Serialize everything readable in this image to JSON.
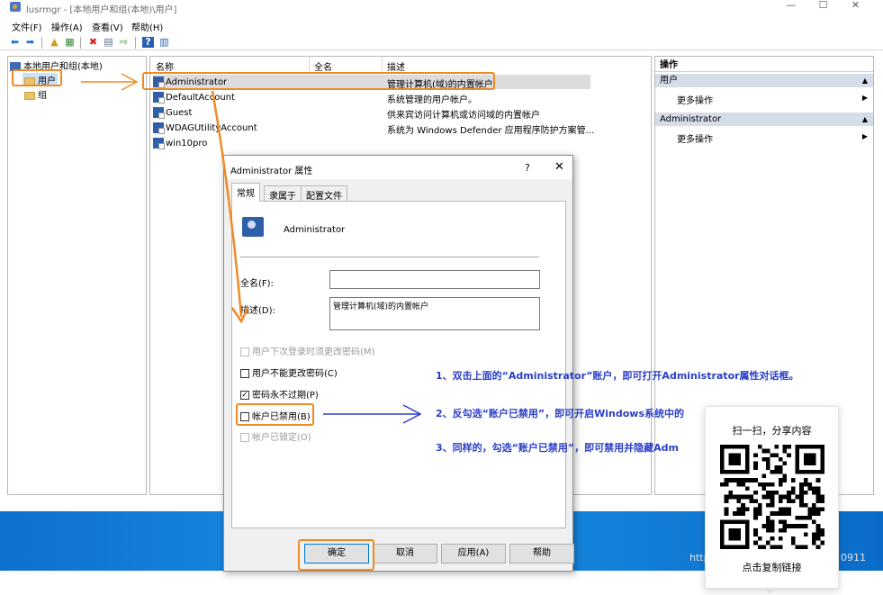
{
  "window": {
    "title": "lusrmgr - [本地用户和组(本地)\\用户]",
    "controls": {
      "minimize": "—",
      "maximize": "☐",
      "close": "✕"
    }
  },
  "menu": [
    "文件(F)",
    "操作(A)",
    "查看(V)",
    "帮助(H)"
  ],
  "toolbar": {
    "icons": [
      "back-icon",
      "forward-icon",
      "up-icon",
      "show-tree-icon",
      "delete-icon",
      "properties-icon",
      "export-icon",
      "help-icon",
      "view-icon"
    ],
    "glyphs": [
      "⬅",
      "➡",
      "▲",
      "▦",
      "✖",
      "▤",
      "⇨",
      "?",
      "▥"
    ]
  },
  "tree": {
    "root": "本地用户和组(本地)",
    "items": [
      "用户",
      "组"
    ]
  },
  "list": {
    "columns": [
      "名称",
      "全名",
      "描述"
    ],
    "rows": [
      {
        "name": "Administrator",
        "fullname": "",
        "desc": "管理计算机(域)的内置帐户"
      },
      {
        "name": "DefaultAccount",
        "fullname": "",
        "desc": "系统管理的用户帐户。"
      },
      {
        "name": "Guest",
        "fullname": "",
        "desc": "供来宾访问计算机或访问域的内置帐户"
      },
      {
        "name": "WDAGUtilityAccount",
        "fullname": "",
        "desc": "系统为 Windows Defender 应用程序防护方案管..."
      },
      {
        "name": "win10pro",
        "fullname": "",
        "desc": ""
      }
    ]
  },
  "actions": {
    "header": "操作",
    "sections": [
      {
        "title": "用户",
        "sub": "更多操作"
      },
      {
        "title": "Administrator",
        "sub": "更多操作"
      }
    ]
  },
  "dialog": {
    "title": "Administrator 属性",
    "help": "?",
    "close": "✕",
    "tabs": [
      "常规",
      "隶属于",
      "配置文件"
    ],
    "username": "Administrator",
    "fullname_label": "全名(F):",
    "fullname_value": "",
    "desc_label": "描述(D):",
    "desc_value": "管理计算机(域)的内置帐户",
    "checkboxes": [
      {
        "label": "用户下次登录时须更改密码(M)",
        "checked": false,
        "disabled": true
      },
      {
        "label": "用户不能更改密码(C)",
        "checked": false,
        "disabled": false
      },
      {
        "label": "密码永不过期(P)",
        "checked": true,
        "disabled": false
      },
      {
        "label": "帐户已禁用(B)",
        "checked": false,
        "disabled": false
      },
      {
        "label": "帐户已锁定(O)",
        "checked": false,
        "disabled": true
      }
    ],
    "buttons": [
      "确定",
      "取消",
      "应用(A)",
      "帮助"
    ]
  },
  "annotations": {
    "step1": "1、双击上面的“Administrator”账户，即可打开Administrator属性对话框。",
    "step2": "2、反勾选“账户已禁用”，即可开启Windows系统中的",
    "step3": "3、同样的，勾选“账户已禁用”，即可禁用并隐藏Adm"
  },
  "taskbar": {
    "left_text": "http",
    "right_text": "0911"
  },
  "share": {
    "title": "扫一扫，分享内容",
    "link": "点击复制链接"
  },
  "colors": {
    "highlight": "#f08a24",
    "annotation": "#2b3fc7",
    "taskbar": "#1c90e6",
    "selection": "#d5dde9"
  }
}
